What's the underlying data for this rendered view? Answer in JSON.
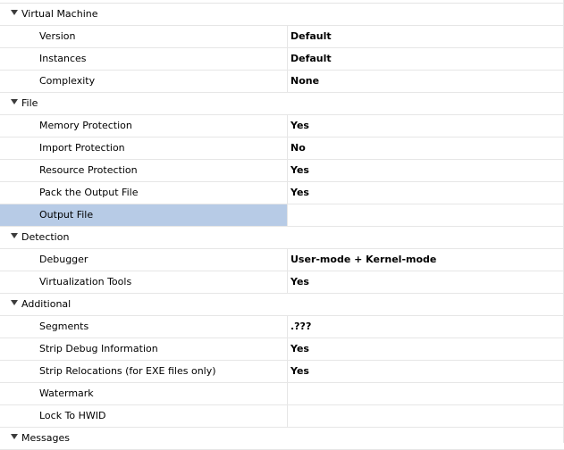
{
  "categories": [
    {
      "label": "Virtual Machine",
      "properties": [
        {
          "name": "Version",
          "value": "Default"
        },
        {
          "name": "Instances",
          "value": "Default"
        },
        {
          "name": "Complexity",
          "value": "None"
        }
      ]
    },
    {
      "label": "File",
      "properties": [
        {
          "name": "Memory Protection",
          "value": "Yes"
        },
        {
          "name": "Import Protection",
          "value": "No"
        },
        {
          "name": "Resource Protection",
          "value": "Yes"
        },
        {
          "name": "Pack the Output File",
          "value": "Yes"
        },
        {
          "name": "Output File",
          "value": ""
        }
      ]
    },
    {
      "label": "Detection",
      "properties": [
        {
          "name": "Debugger",
          "value": "User-mode + Kernel-mode"
        },
        {
          "name": "Virtualization Tools",
          "value": "Yes"
        }
      ]
    },
    {
      "label": "Additional",
      "properties": [
        {
          "name": "Segments",
          "value": ".???"
        },
        {
          "name": "Strip Debug Information",
          "value": "Yes"
        },
        {
          "name": "Strip Relocations (for EXE files only)",
          "value": "Yes"
        },
        {
          "name": "Watermark",
          "value": ""
        },
        {
          "name": "Lock To HWID",
          "value": ""
        }
      ]
    },
    {
      "label": "Messages",
      "properties": []
    }
  ],
  "selected": "Output File",
  "colors": {
    "selection": "#b7cbe6",
    "gridline": "#e6e6e6"
  },
  "icons": {
    "expanded": "triangle-down-icon"
  }
}
